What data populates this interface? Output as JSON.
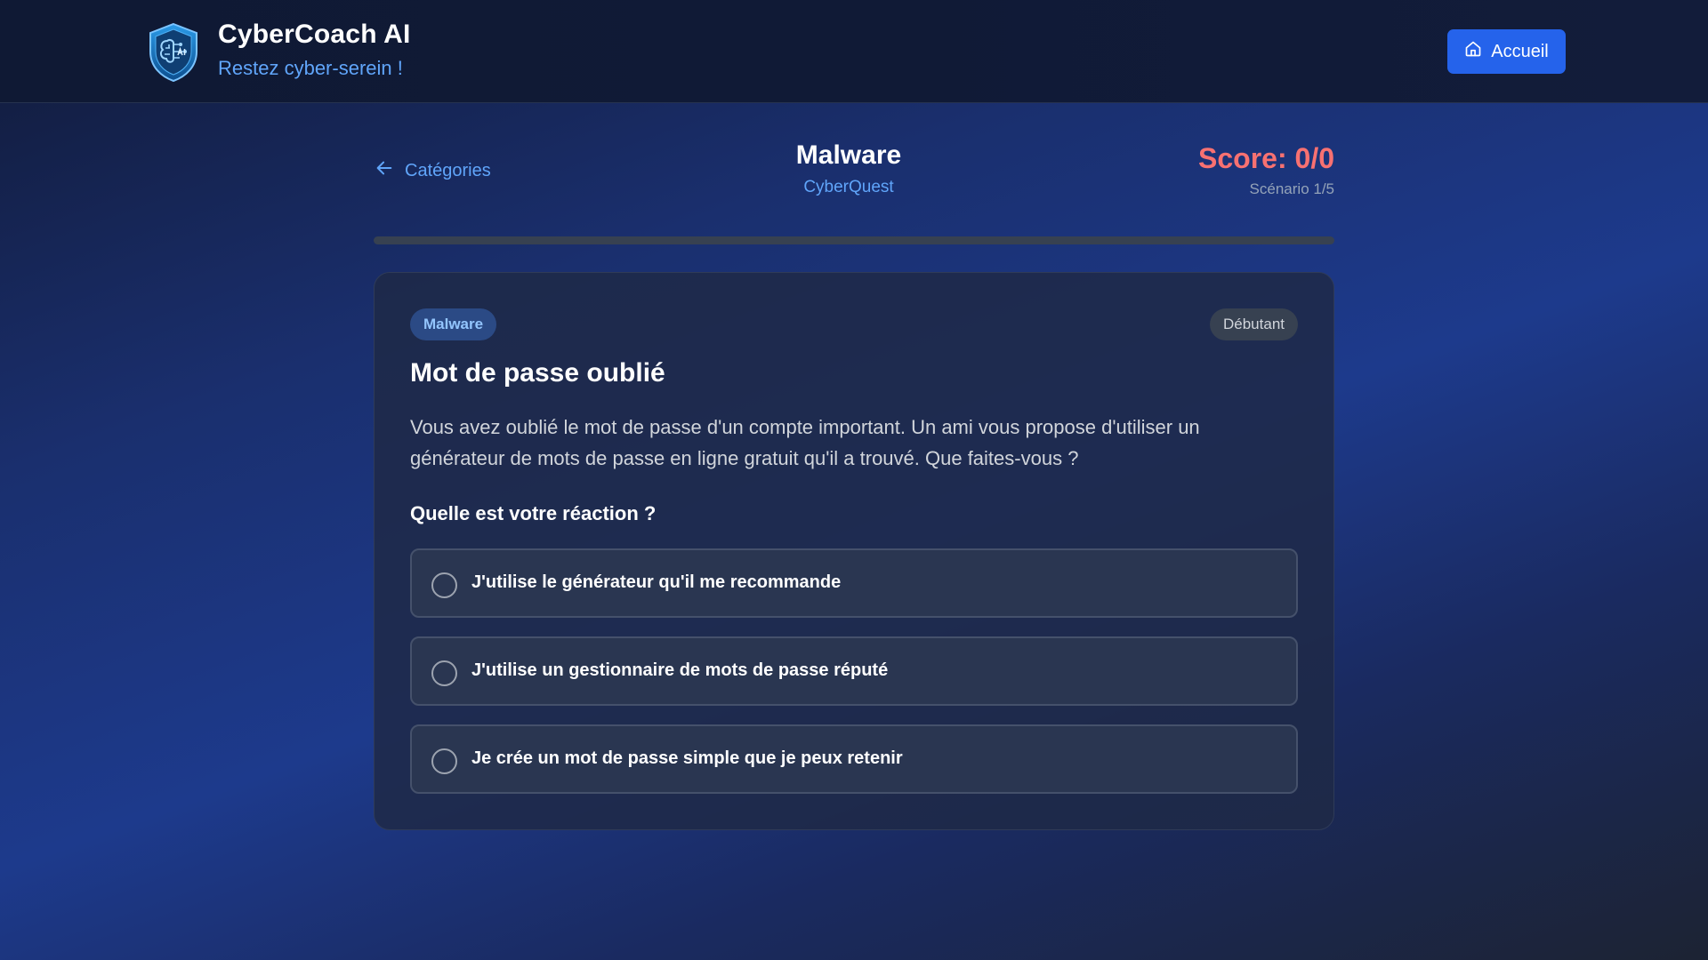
{
  "header": {
    "logo_icon": "shield-brain-ai-icon",
    "title": "CyberCoach AI",
    "tagline": "Restez cyber-serein !",
    "home_button": {
      "icon": "home-icon",
      "label": "Accueil"
    }
  },
  "quiz": {
    "back_link": {
      "icon": "arrow-left-icon",
      "label": "Catégories"
    },
    "category_title": "Malware",
    "subtitle": "CyberQuest",
    "score": "Score: 0/0",
    "scenario_counter": "Scénario 1/5",
    "progress": 0.0
  },
  "card": {
    "tag": "Malware",
    "level": "Débutant",
    "title": "Mot de passe oublié",
    "description": "Vous avez oublié le mot de passe d'un compte important. Un ami vous propose d'utiliser un générateur de mots de passe en ligne gratuit qu'il a trouvé. Que faites-vous ?",
    "question": "Quelle est votre réaction ?",
    "options": [
      {
        "label": "J'utilise le générateur qu'il me recommande",
        "selected": false
      },
      {
        "label": "J'utilise un gestionnaire de mots de passe réputé",
        "selected": false
      },
      {
        "label": "Je crée un mot de passe simple que je peux retenir",
        "selected": false
      }
    ]
  },
  "colors": {
    "accent": "#2563eb",
    "link": "#60a5fa",
    "score": "#f87171"
  }
}
